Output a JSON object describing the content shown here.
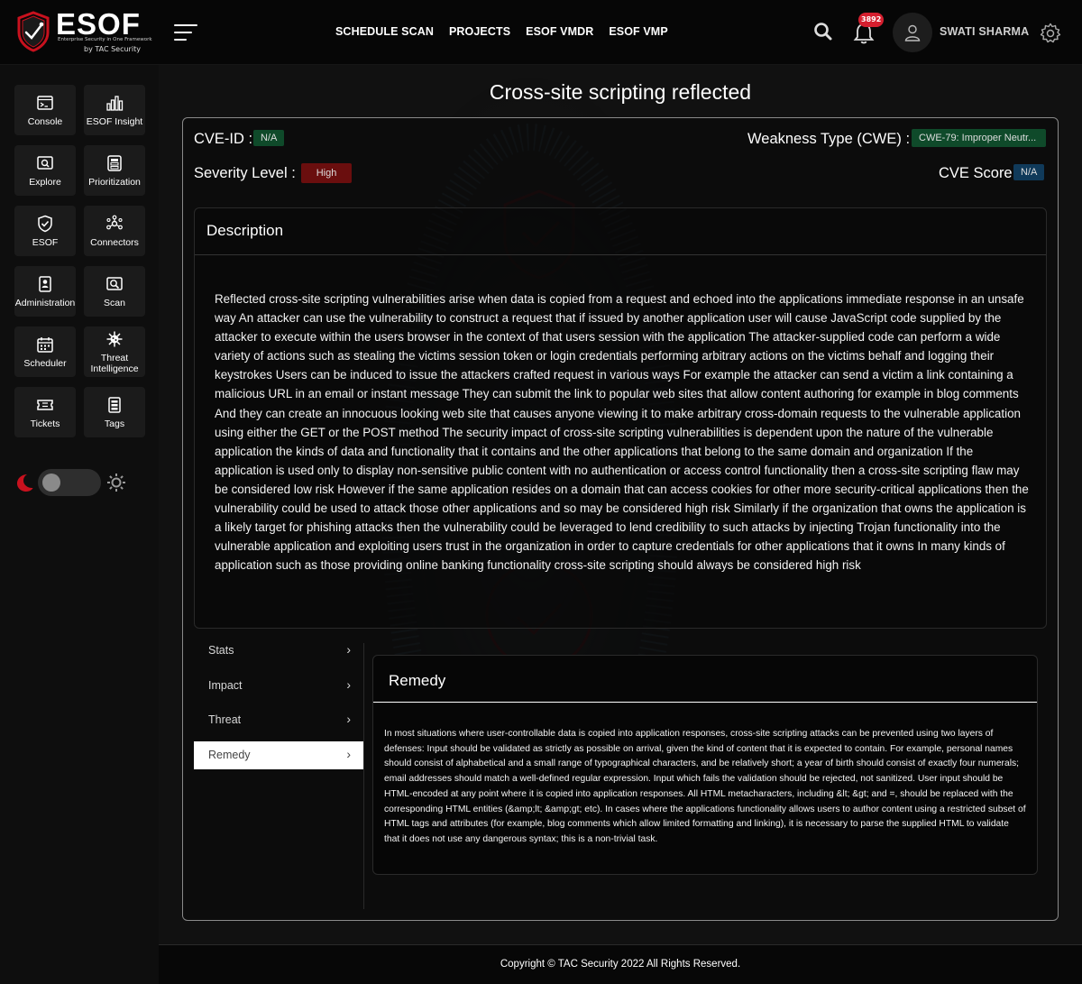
{
  "brand": {
    "name": "ESOF",
    "tagline": "Enterprise Security in One Framework",
    "by": "by TAC Security"
  },
  "nav": {
    "links": [
      "SCHEDULE SCAN",
      "PROJECTS",
      "ESOF VMDR",
      "ESOF VMP"
    ],
    "notification_count": "3892",
    "username": "SWATI SHARMA"
  },
  "sidebar": {
    "items": [
      {
        "label": "Console",
        "icon": "console-icon"
      },
      {
        "label": "ESOF Insight",
        "icon": "bar-chart-icon"
      },
      {
        "label": "Explore",
        "icon": "explore-icon"
      },
      {
        "label": "Prioritization",
        "icon": "prioritization-icon"
      },
      {
        "label": "ESOF",
        "icon": "shield-check-icon"
      },
      {
        "label": "Connectors",
        "icon": "connectors-icon"
      },
      {
        "label": "Administration",
        "icon": "administration-icon"
      },
      {
        "label": "Scan",
        "icon": "scan-icon"
      },
      {
        "label": "Scheduler",
        "icon": "calendar-icon"
      },
      {
        "label": "Threat Intelligence",
        "icon": "virus-icon"
      },
      {
        "label": "Tickets",
        "icon": "ticket-icon"
      },
      {
        "label": "Tags",
        "icon": "tags-icon"
      }
    ],
    "theme_toggle": {
      "mode": "dark"
    }
  },
  "page": {
    "title": "Cross-site scripting reflected",
    "cve_id_label": "CVE-ID :",
    "cve_id": "N/A",
    "cwe_label": "Weakness Type (CWE) :",
    "cwe": "CWE-79: Improper Neutr...",
    "severity_label": "Severity Level :",
    "severity": "High",
    "cve_score_label": "CVE Score:",
    "cve_score": "N/A",
    "colors": {
      "cve_pill": "#0f4a2a",
      "cwe_pill": "#0f4a2a",
      "severity_pill": "#6a0e0e",
      "score_pill": "#103a5a"
    }
  },
  "description": {
    "heading": "Description",
    "text": "Reflected cross-site scripting vulnerabilities arise when data is copied from a request and echoed into the applications immediate response in an unsafe way An attacker can use the vulnerability to construct a request that if issued by another application user will cause JavaScript code supplied by the attacker to execute within the users browser in the context of that users session with the application The attacker-supplied code can perform a wide variety of actions such as stealing the victims session token or login credentials performing arbitrary actions on the victims behalf and logging their keystrokes Users can be induced to issue the attackers crafted request in various ways For example the attacker can send a victim a link containing a malicious URL in an email or instant message They can submit the link to popular web sites that allow content authoring for example in blog comments And they can create an innocuous looking web site that causes anyone viewing it to make arbitrary cross-domain requests to the vulnerable application using either the GET or the POST method The security impact of cross-site scripting vulnerabilities is dependent upon the nature of the vulnerable application the kinds of data and functionality that it contains and the other applications that belong to the same domain and organization If the application is used only to display non-sensitive public content with no authentication or access control functionality then a cross-site scripting flaw may be considered low risk However if the same application resides on a domain that can access cookies for other more security-critical applications then the vulnerability could be used to attack those other applications and so may be considered high risk Similarly if the organization that owns the application is a likely target for phishing attacks then the vulnerability could be leveraged to lend credibility to such attacks by injecting Trojan functionality into the vulnerable application and exploiting users trust in the organization in order to capture credentials for other applications that it owns In many kinds of application such as those providing online banking functionality cross-site scripting should always be considered high risk"
  },
  "tabs": {
    "items": [
      "Stats",
      "Impact",
      "Threat",
      "Remedy"
    ],
    "active": "Remedy",
    "chevron": "›"
  },
  "remedy": {
    "heading": "Remedy",
    "text": "In most situations where user-controllable data is copied into application responses, cross-site scripting attacks can be prevented using two layers of defenses: Input should be validated as strictly as possible on arrival, given the kind of content that it is expected to contain. For example, personal names should consist of alphabetical and a small range of typographical characters, and be relatively short; a year of birth should consist of exactly four numerals; email addresses should match a well-defined regular expression. Input which fails the validation should be rejected, not sanitized. User input should be HTML-encoded at any point where it is copied into application responses. All HTML metacharacters, including &lt; &gt; and =, should be replaced with the corresponding HTML entities (&amp;lt; &amp;gt; etc). In cases where the applications functionality allows users to author content using a restricted subset of HTML tags and attributes (for example, blog comments which allow limited formatting and linking), it is necessary to parse the supplied HTML to validate that it does not use any dangerous syntax; this is a non-trivial task."
  },
  "footer": {
    "text": "Copyright © TAC Security 2022 All Rights Reserved."
  }
}
